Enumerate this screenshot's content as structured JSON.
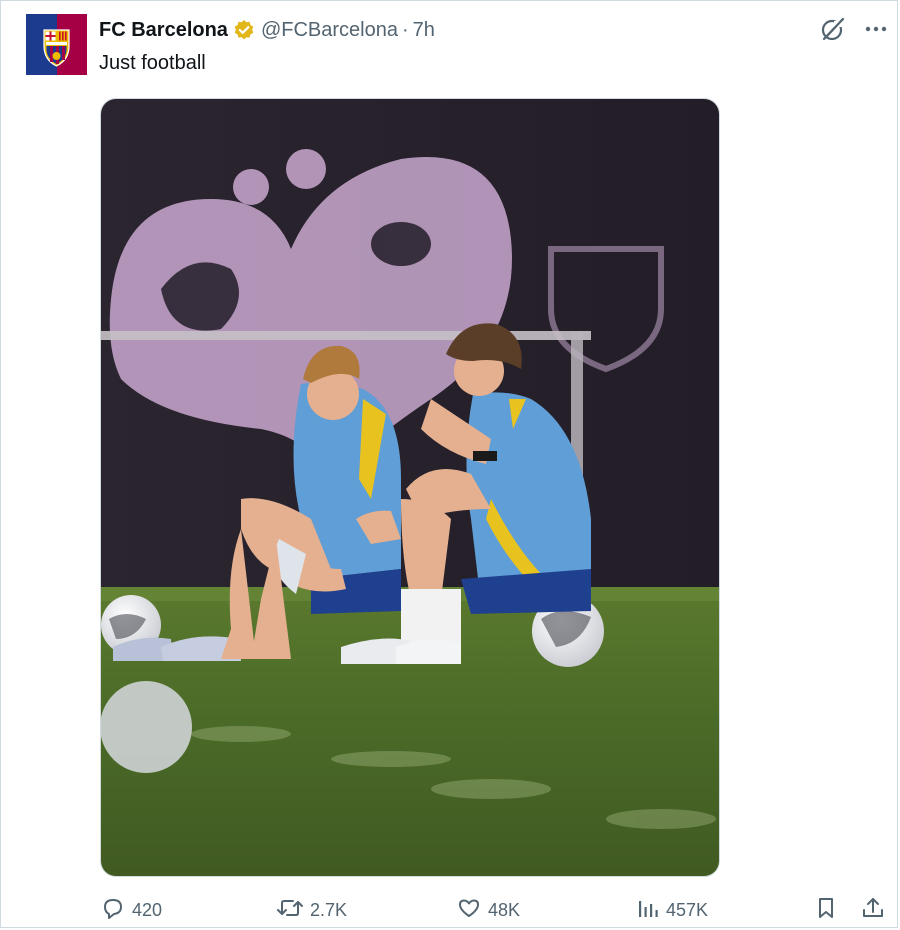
{
  "post": {
    "author_name": "FC Barcelona",
    "handle": "@FCBarcelona",
    "separator": "·",
    "time": "7h",
    "text": "Just football",
    "verified_color": "#e2b719"
  },
  "icons": {
    "grok": "grok-icon",
    "more": "more-icon",
    "reply": "reply-icon",
    "repost": "repost-icon",
    "like": "like-icon",
    "views": "views-icon",
    "bookmark": "bookmark-icon",
    "share": "share-icon"
  },
  "stats": {
    "replies": "420",
    "reposts": "2.7K",
    "likes": "48K",
    "views": "457K"
  },
  "colors": {
    "text": "#0f1419",
    "muted": "#536471",
    "barca_blue": "#1c3a8e",
    "barca_red": "#a50044"
  }
}
